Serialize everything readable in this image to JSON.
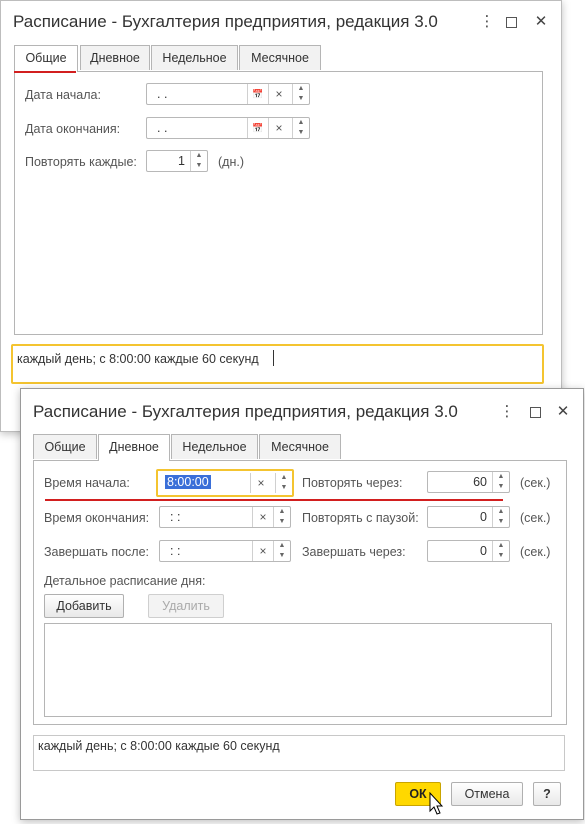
{
  "back_window": {
    "title": "Расписание - Бухгалтерия предприятия, редакция 3.0",
    "tabs": [
      "Общие",
      "Дневное",
      "Недельное",
      "Месячное"
    ],
    "start_date": {
      "label": "Дата начала:",
      "value": ".  ."
    },
    "end_date": {
      "label": "Дата окончания:",
      "value": ".  ."
    },
    "repeat": {
      "label": "Повторять каждые:",
      "value": "1",
      "unit": "(дн.)"
    },
    "summary": "каждый день; с 8:00:00 каждые 60 секунд"
  },
  "front_window": {
    "title": "Расписание - Бухгалтерия предприятия, редакция 3.0",
    "tabs": [
      "Общие",
      "Дневное",
      "Недельное",
      "Месячное"
    ],
    "start_time": {
      "label": "Время начала:",
      "value": "8:00:00"
    },
    "end_time": {
      "label": "Время окончания:",
      "value": ":  :"
    },
    "finish_after": {
      "label": "Завершать после:",
      "value": ":  :"
    },
    "repeat_every": {
      "label": "Повторять через:",
      "value": "60",
      "unit": "(сек.)"
    },
    "repeat_pause": {
      "label": "Повторять с паузой:",
      "value": "0",
      "unit": "(сек.)"
    },
    "finish_in": {
      "label": "Завершать через:",
      "value": "0",
      "unit": "(сек.)"
    },
    "detail_label": "Детальное расписание дня:",
    "add_button": "Добавить",
    "delete_button": "Удалить",
    "summary": "каждый день; с 8:00:00 каждые 60 секунд",
    "ok_button": "ОК",
    "cancel_button": "Отмена",
    "help_button": "?"
  },
  "icons": {
    "calendar": "📅",
    "clear": "×",
    "up": "▲",
    "down": "▼",
    "more": "⋮",
    "maximize": "□",
    "close": "✕"
  },
  "colors": {
    "accent_red": "#d21f1f",
    "highlight_yellow": "#f4c430",
    "ok_yellow": "#ffd800",
    "selection_blue": "#3a6fd8"
  }
}
